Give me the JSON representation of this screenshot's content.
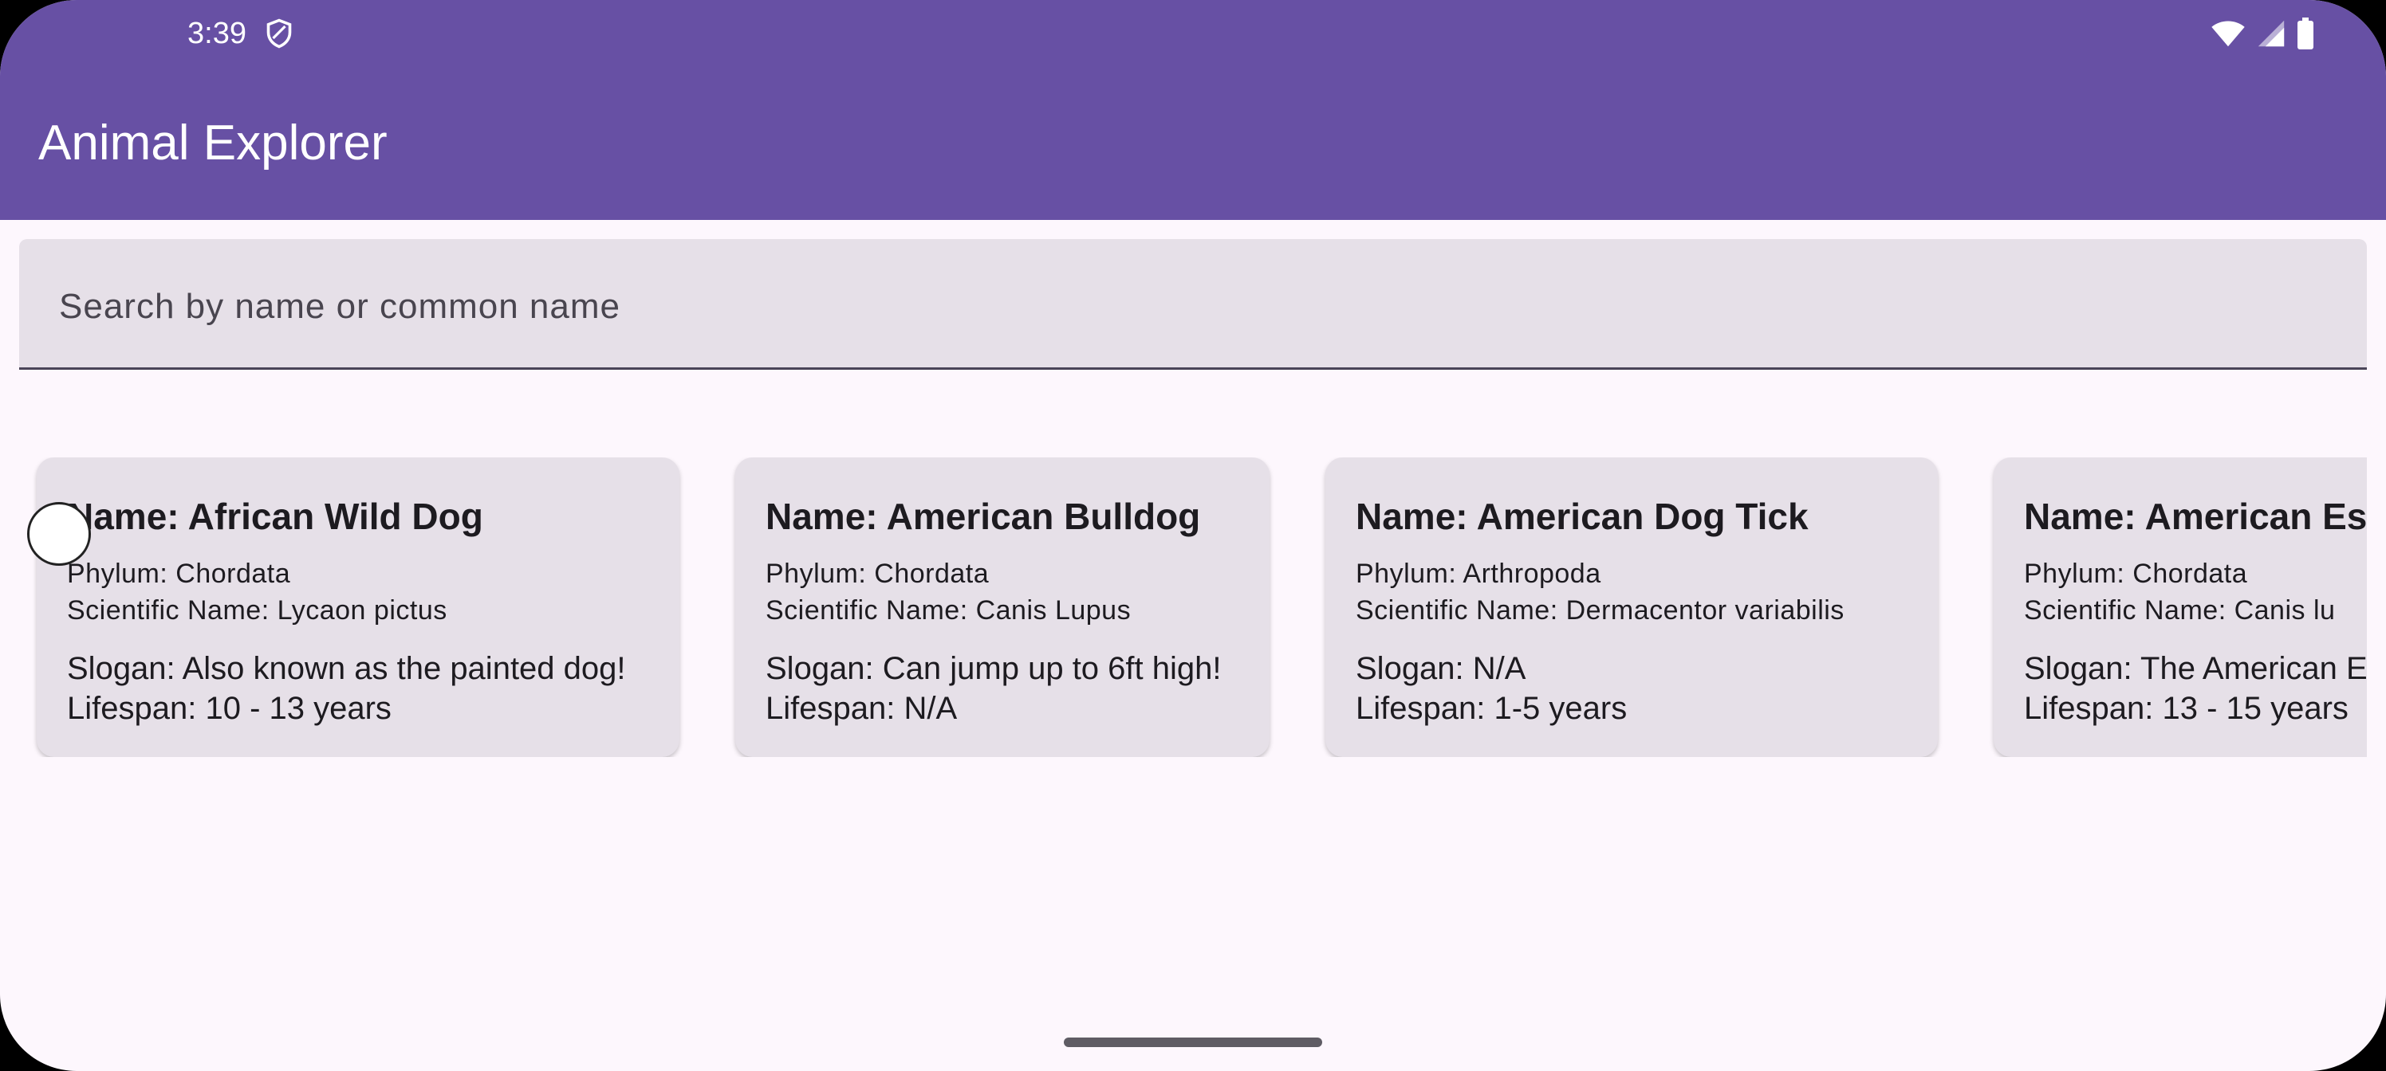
{
  "status_bar": {
    "time": "3:39",
    "icons": [
      "shield-icon",
      "wifi-icon",
      "cellular-signal-icon",
      "battery-icon"
    ]
  },
  "app_bar": {
    "title": "Animal Explorer"
  },
  "search": {
    "placeholder": "Search by name or common name",
    "value": ""
  },
  "cards": [
    {
      "name": "Name: African Wild Dog",
      "phylum": "Phylum: Chordata",
      "scientific_name": "Scientific Name: Lycaon pictus",
      "slogan": "Slogan: Also known as the painted dog!",
      "lifespan": "Lifespan: 10 - 13 years"
    },
    {
      "name": "Name: American Bulldog",
      "phylum": "Phylum: Chordata",
      "scientific_name": "Scientific Name: Canis Lupus",
      "slogan": "Slogan: Can jump up to 6ft high!",
      "lifespan": "Lifespan: N/A"
    },
    {
      "name": "Name: American Dog Tick",
      "phylum": "Phylum: Arthropoda",
      "scientific_name": "Scientific Name: Dermacentor variabilis",
      "slogan": "Slogan: N/A",
      "lifespan": "Lifespan: 1-5 years"
    },
    {
      "name": "Name: American Es",
      "phylum": "Phylum: Chordata",
      "scientific_name": "Scientific Name: Canis lu",
      "slogan": "Slogan: The American E",
      "lifespan": "Lifespan: 13 - 15 years"
    }
  ],
  "colors": {
    "primary": "#6750a4",
    "background": "#fdf7fd",
    "card_surface": "#e6e0e8",
    "text": "#1d1b20"
  }
}
